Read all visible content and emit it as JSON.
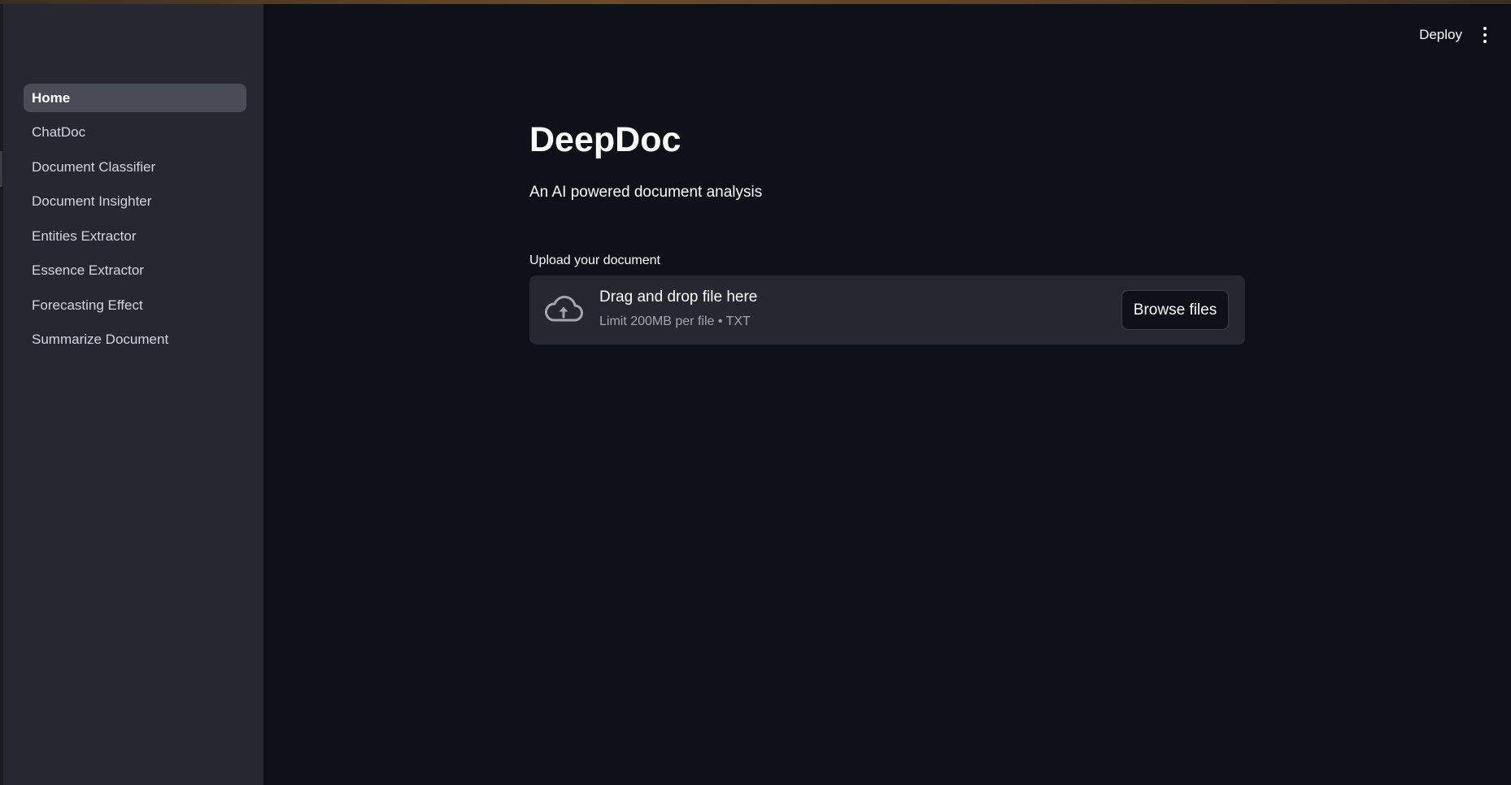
{
  "sidebar": {
    "items": [
      {
        "label": "Home",
        "active": true
      },
      {
        "label": "ChatDoc",
        "active": false
      },
      {
        "label": "Document Classifier",
        "active": false
      },
      {
        "label": "Document Insighter",
        "active": false
      },
      {
        "label": "Entities Extractor",
        "active": false
      },
      {
        "label": "Essence Extractor",
        "active": false
      },
      {
        "label": "Forecasting Effect",
        "active": false
      },
      {
        "label": "Summarize Document",
        "active": false
      }
    ]
  },
  "header": {
    "deploy_label": "Deploy",
    "menu_icon": "vertical-ellipsis-icon"
  },
  "main": {
    "title": "DeepDoc",
    "subtitle": "An AI powered document analysis",
    "uploader": {
      "label": "Upload your document",
      "drop_title": "Drag and drop file here",
      "limit_text": "Limit 200MB per file • TXT",
      "browse_label": "Browse files",
      "icon": "cloud-upload-icon"
    }
  },
  "colors": {
    "background": "#0e1117",
    "sidebar": "#262730",
    "active_item": "#494b56",
    "text": "#fafafa",
    "muted_text": "#a3a6ad"
  }
}
